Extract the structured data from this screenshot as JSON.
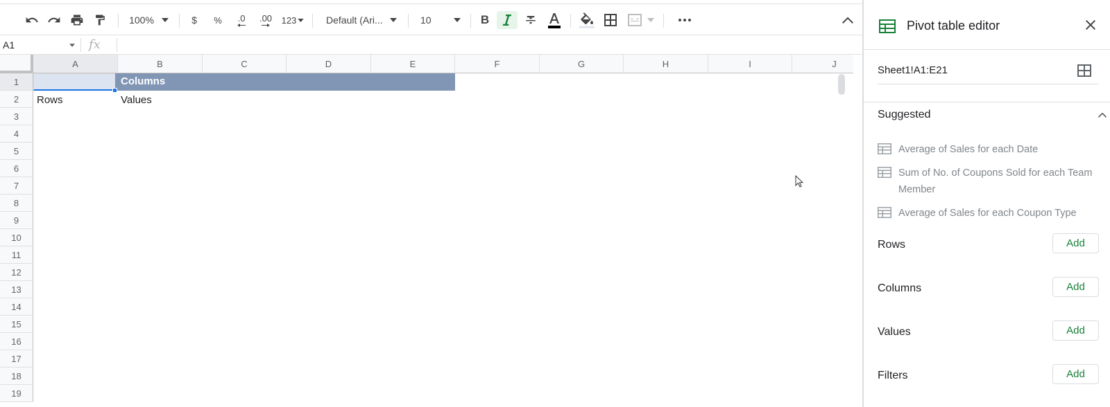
{
  "toolbar": {
    "zoom": "100%",
    "currency": "$",
    "percent": "%",
    "dec_decrease": ".0",
    "dec_increase": ".00",
    "number_format": "123",
    "font": "Default (Ari...",
    "font_size": "10",
    "bold": "B"
  },
  "formula_bar": {
    "name_box": "A1",
    "fx": "fx"
  },
  "grid": {
    "columns": [
      "A",
      "B",
      "C",
      "D",
      "E",
      "F",
      "G",
      "H",
      "I",
      "J"
    ],
    "rows": [
      "1",
      "2",
      "3",
      "4",
      "5",
      "6",
      "7",
      "8",
      "9",
      "10",
      "11",
      "12",
      "13",
      "14",
      "15",
      "16",
      "17",
      "18",
      "19"
    ],
    "b1": "Columns",
    "a2": "Rows",
    "b2": "Values"
  },
  "panel": {
    "title": "Pivot table editor",
    "range": "Sheet1!A1:E21",
    "suggested_label": "Suggested",
    "suggestions": [
      "Average of Sales for each Date",
      "Sum of No. of Coupons Sold for each Team Member",
      "Average of Sales for each Coupon Type"
    ],
    "sections": [
      {
        "label": "Rows",
        "button": "Add"
      },
      {
        "label": "Columns",
        "button": "Add"
      },
      {
        "label": "Values",
        "button": "Add"
      },
      {
        "label": "Filters",
        "button": "Add"
      }
    ]
  },
  "colors": {
    "header_band": "#8195b5",
    "accent_green": "#188038",
    "selection_blue": "#1a73e8"
  }
}
